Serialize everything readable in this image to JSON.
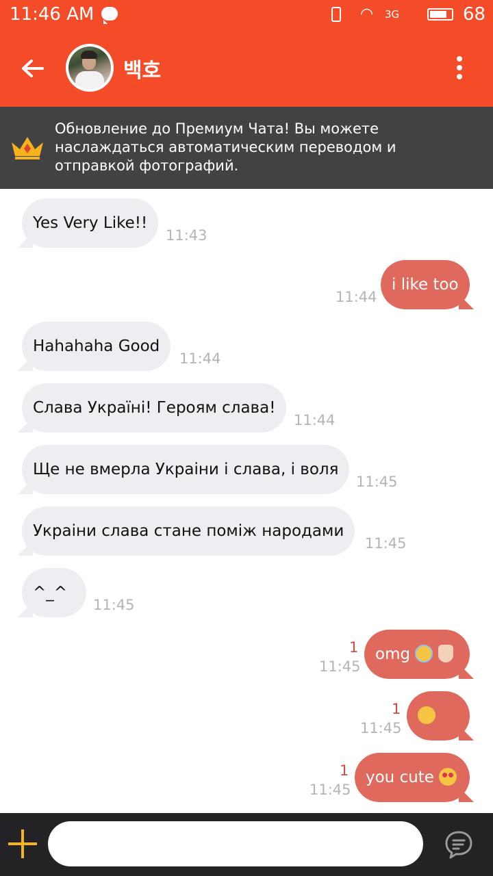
{
  "status_bar": {
    "time": "11:46 AM",
    "network": "3G",
    "battery": "68",
    "battery_level": 0.68
  },
  "header": {
    "title": "백호",
    "avatar_alt": "contact avatar"
  },
  "promo": {
    "text": "Обновление до Премиум Чата! Вы можете наслаждаться автоматическим переводом и отправкой фотографий."
  },
  "messages": [
    {
      "direction": "in",
      "text": "Yes Very Like!!",
      "time": "11:43"
    },
    {
      "direction": "out",
      "text": "i like too",
      "time": "11:44"
    },
    {
      "direction": "in",
      "text": "Hahahaha Good",
      "time": "11:44"
    },
    {
      "direction": "in",
      "text": "Слава Україні! Героям слава!",
      "time": "11:44"
    },
    {
      "direction": "in",
      "text": "Ще не вмерла Украіни і слава, і воля",
      "time": "11:45"
    },
    {
      "direction": "in",
      "text": "Украіни слава стане поміж народами",
      "time": "11:45"
    },
    {
      "direction": "in",
      "text": "^_^",
      "time": "11:45"
    },
    {
      "direction": "out",
      "text": "omg",
      "emoji": [
        "smiling-face-with-halo",
        "folded-hands"
      ],
      "time": "11:45",
      "unread": "1"
    },
    {
      "direction": "out",
      "text": "",
      "emoji": [
        "hugging-face"
      ],
      "time": "11:45",
      "unread": "1"
    },
    {
      "direction": "out",
      "text": "you cute",
      "emoji": [
        "smiling-face-with-heart-eyes"
      ],
      "time": "11:45",
      "unread": "1"
    }
  ],
  "composer": {
    "placeholder": ""
  },
  "colors": {
    "accent": "#f44c28",
    "outgoing_bubble": "#e0695d",
    "incoming_bubble": "#eeeef2",
    "promo_bg": "#424244",
    "input_bar_bg": "#232325",
    "plus_icon": "#f5b31d"
  }
}
